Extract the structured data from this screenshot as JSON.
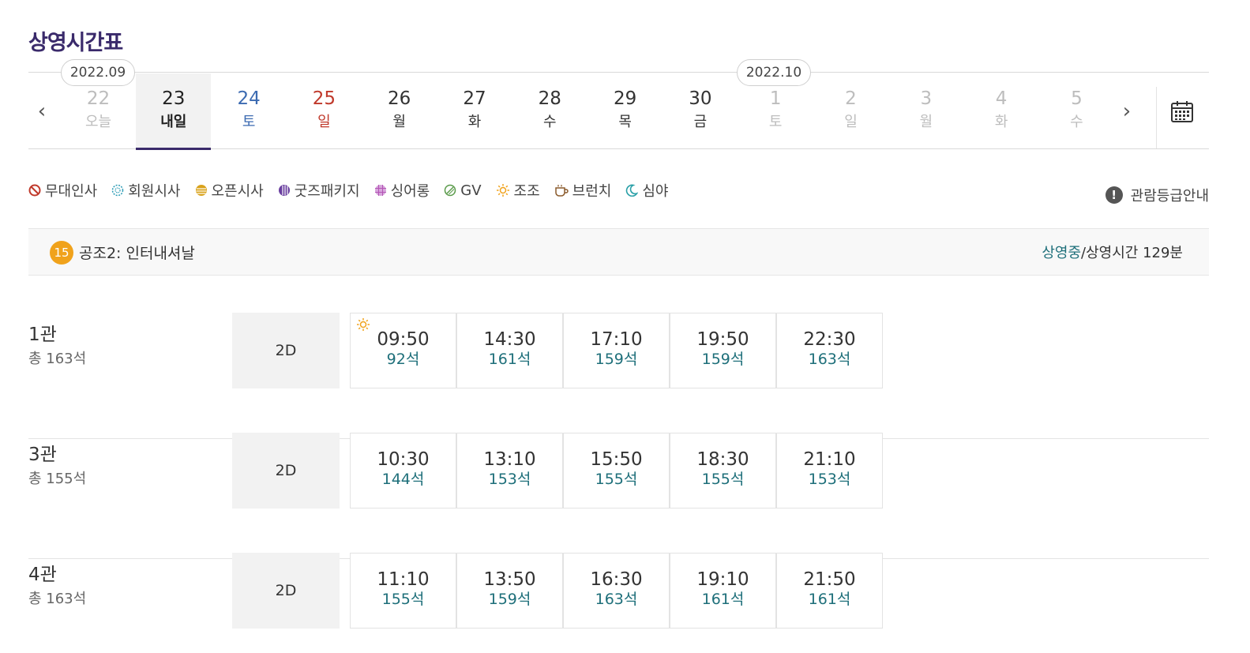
{
  "page_title": "상영시간표",
  "date_nav": {
    "months": [
      {
        "label": "2022.09"
      },
      {
        "label": "2022.10"
      }
    ],
    "days": [
      {
        "num": "22",
        "dow": "오늘",
        "kind": "disabled"
      },
      {
        "num": "23",
        "dow": "내일",
        "kind": "selected"
      },
      {
        "num": "24",
        "dow": "토",
        "kind": "sat"
      },
      {
        "num": "25",
        "dow": "일",
        "kind": "sun"
      },
      {
        "num": "26",
        "dow": "월",
        "kind": "weekday"
      },
      {
        "num": "27",
        "dow": "화",
        "kind": "weekday"
      },
      {
        "num": "28",
        "dow": "수",
        "kind": "weekday"
      },
      {
        "num": "29",
        "dow": "목",
        "kind": "weekday"
      },
      {
        "num": "30",
        "dow": "금",
        "kind": "weekday"
      },
      {
        "num": "1",
        "dow": "토",
        "kind": "disabled"
      },
      {
        "num": "2",
        "dow": "일",
        "kind": "disabled"
      },
      {
        "num": "3",
        "dow": "월",
        "kind": "disabled"
      },
      {
        "num": "4",
        "dow": "화",
        "kind": "disabled"
      },
      {
        "num": "5",
        "dow": "수",
        "kind": "disabled"
      }
    ],
    "prev_icon": "chevron-left-icon",
    "next_icon": "chevron-right-icon",
    "calendar_icon": "calendar-icon"
  },
  "legend": [
    {
      "label": "무대인사",
      "icon": "no-sign-icon",
      "color": "#c0392b"
    },
    {
      "label": "회원시사",
      "icon": "dotted-circle-icon",
      "color": "#2a9bb5"
    },
    {
      "label": "오픈시사",
      "icon": "striped-circle-icon",
      "color": "#d9a21b"
    },
    {
      "label": "굿즈패키지",
      "icon": "striped-circle-icon",
      "color": "#6a3fa0"
    },
    {
      "label": "싱어롱",
      "icon": "grid-circle-icon",
      "color": "#b455b5"
    },
    {
      "label": "GV",
      "icon": "slash-circle-icon",
      "color": "#5a9a4a"
    },
    {
      "label": "조조",
      "icon": "sun-icon",
      "color": "#f0a21b"
    },
    {
      "label": "브런치",
      "icon": "cup-icon",
      "color": "#8a5a2b"
    },
    {
      "label": "심야",
      "icon": "moon-icon",
      "color": "#2aa0a8"
    }
  ],
  "rating_guide": {
    "label": "관람등급안내",
    "icon": "info-icon"
  },
  "movie": {
    "age_rating": "15",
    "title": "공조2: 인터내셔날",
    "status_now": "상영중",
    "status_rest": "/상영시간 129분"
  },
  "halls": [
    {
      "name": "1관",
      "seats": "총 163석",
      "format": "2D",
      "times": [
        {
          "time": "09:50",
          "seats": "92석",
          "morning": true
        },
        {
          "time": "14:30",
          "seats": "161석"
        },
        {
          "time": "17:10",
          "seats": "159석"
        },
        {
          "time": "19:50",
          "seats": "159석"
        },
        {
          "time": "22:30",
          "seats": "163석"
        }
      ]
    },
    {
      "name": "3관",
      "seats": "총 155석",
      "format": "2D",
      "times": [
        {
          "time": "10:30",
          "seats": "144석"
        },
        {
          "time": "13:10",
          "seats": "153석"
        },
        {
          "time": "15:50",
          "seats": "155석"
        },
        {
          "time": "18:30",
          "seats": "155석"
        },
        {
          "time": "21:10",
          "seats": "153석"
        }
      ]
    },
    {
      "name": "4관",
      "seats": "총 163석",
      "format": "2D",
      "times": [
        {
          "time": "11:10",
          "seats": "155석"
        },
        {
          "time": "13:50",
          "seats": "159석"
        },
        {
          "time": "16:30",
          "seats": "163석"
        },
        {
          "time": "19:10",
          "seats": "161석"
        },
        {
          "time": "21:50",
          "seats": "161석"
        }
      ]
    }
  ]
}
